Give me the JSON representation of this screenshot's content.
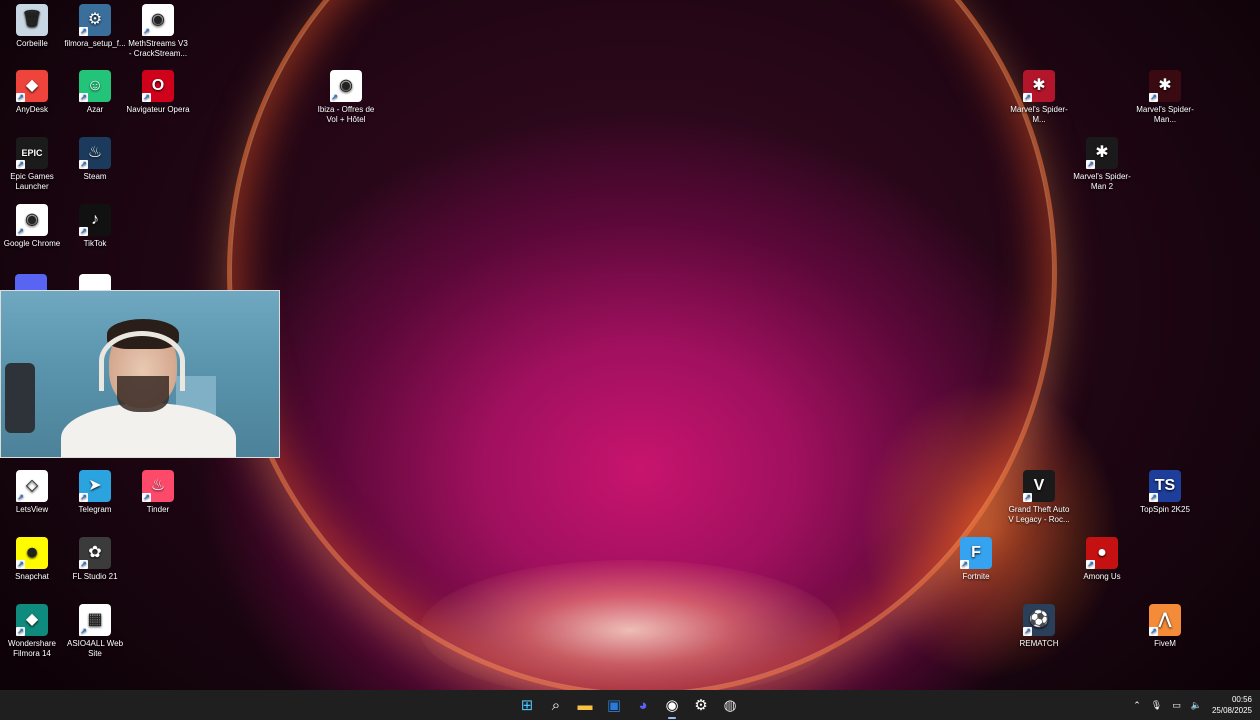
{
  "desktop": {
    "left_icons": [
      {
        "label": "Corbeille",
        "icon": "recycle-bin-icon",
        "color": "#c9d6e3",
        "glyph": "🗑"
      },
      {
        "label": "filmora_setup_f...",
        "icon": "installer-icon",
        "color": "#3a6f9c",
        "glyph": "⚙"
      },
      {
        "label": "MethStreams V3 - CrackStream...",
        "icon": "chrome-icon",
        "color": "#ffffff",
        "glyph": "◉"
      },
      {
        "label": "AnyDesk",
        "icon": "anydesk-icon",
        "color": "#ef443b",
        "glyph": "◆"
      },
      {
        "label": "Azar",
        "icon": "azar-icon",
        "color": "#23c47a",
        "glyph": "☺"
      },
      {
        "label": "Navigateur Opera",
        "icon": "opera-icon",
        "color": "#d0021b",
        "glyph": "O"
      },
      {
        "label": "Epic Games Launcher",
        "icon": "epic-games-icon",
        "color": "#1b1b1b",
        "glyph": "EPIC"
      },
      {
        "label": "Steam",
        "icon": "steam-icon",
        "color": "#1b3a5c",
        "glyph": "♨"
      },
      {
        "label": "Google Chrome",
        "icon": "chrome-icon",
        "color": "#ffffff",
        "glyph": "◉"
      },
      {
        "label": "TikTok",
        "icon": "tiktok-icon",
        "color": "#111111",
        "glyph": "♪"
      },
      {
        "label": "LetsView",
        "icon": "letsview-icon",
        "color": "#ffffff",
        "glyph": "◇"
      },
      {
        "label": "Telegram",
        "icon": "telegram-icon",
        "color": "#2aa3df",
        "glyph": "➤"
      },
      {
        "label": "Tinder",
        "icon": "tinder-icon",
        "color": "#fd4a6b",
        "glyph": "♨"
      },
      {
        "label": "Snapchat",
        "icon": "snapchat-icon",
        "color": "#fffc00",
        "glyph": "☻"
      },
      {
        "label": "FL Studio 21",
        "icon": "fl-studio-icon",
        "color": "#3b3b3b",
        "glyph": "✿"
      },
      {
        "label": "Wondershare Filmora 14",
        "icon": "filmora-icon",
        "color": "#0f8b7d",
        "glyph": "◆"
      },
      {
        "label": "ASIO4ALL Web Site",
        "icon": "asio4all-icon",
        "color": "#ffffff",
        "glyph": "▦"
      }
    ],
    "middle_icons": [
      {
        "label": "Ibiza - Offres de Vol + Hôtel",
        "icon": "chrome-icon",
        "color": "#ffffff",
        "glyph": "◉"
      }
    ],
    "right_icons": [
      {
        "label": "Marvel's Spider-M...",
        "icon": "spiderman-icon",
        "color": "#b3152a",
        "glyph": "✱"
      },
      {
        "label": "Marvel's Spider-Man...",
        "icon": "spiderman-miles-icon",
        "color": "#3a0a12",
        "glyph": "✱"
      },
      {
        "label": "Marvel's Spider-Man 2",
        "icon": "spiderman2-icon",
        "color": "#1a1a1a",
        "glyph": "✱"
      },
      {
        "label": "Grand Theft Auto V Legacy - Roc...",
        "icon": "gta-icon",
        "color": "#1a1a1a",
        "glyph": "V"
      },
      {
        "label": "TopSpin 2K25",
        "icon": "topspin-icon",
        "color": "#1d3e9a",
        "glyph": "TS"
      },
      {
        "label": "Fortnite",
        "icon": "fortnite-icon",
        "color": "#35a3f0",
        "glyph": "F"
      },
      {
        "label": "Among Us",
        "icon": "among-us-icon",
        "color": "#c51111",
        "glyph": "●"
      },
      {
        "label": "REMATCH",
        "icon": "rematch-icon",
        "color": "#2a3f5a",
        "glyph": "⚽"
      },
      {
        "label": "FiveM",
        "icon": "fivem-icon",
        "color": "#f38b38",
        "glyph": "⋀"
      }
    ]
  },
  "webcam": {
    "label": "webcam-overlay"
  },
  "taskbar": {
    "apps": [
      {
        "name": "start-button",
        "icon": "windows-icon",
        "glyph": "⊞",
        "color": "#4cc2ff"
      },
      {
        "name": "search-button",
        "icon": "search-icon",
        "glyph": "⌕",
        "color": "#ffffff"
      },
      {
        "name": "file-explorer-button",
        "icon": "folder-icon",
        "glyph": "▬",
        "color": "#f6c343"
      },
      {
        "name": "photos-button",
        "icon": "photos-icon",
        "glyph": "▣",
        "color": "#2b7ad6"
      },
      {
        "name": "discord-button",
        "icon": "discord-icon",
        "glyph": "◕",
        "color": "#5865f2"
      },
      {
        "name": "chrome-button",
        "icon": "chrome-icon",
        "glyph": "◉",
        "color": "#ffffff"
      },
      {
        "name": "steam-button",
        "icon": "steam-icon",
        "glyph": "⚙",
        "color": "#ffffff"
      },
      {
        "name": "obs-button",
        "icon": "obs-icon",
        "glyph": "◍",
        "color": "#dddddd"
      }
    ],
    "time": "00:56",
    "date": "25/08/2025"
  }
}
